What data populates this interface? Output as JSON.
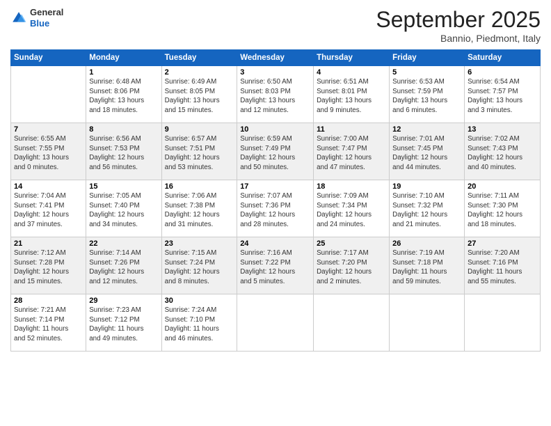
{
  "logo": {
    "general": "General",
    "blue": "Blue"
  },
  "header": {
    "month": "September 2025",
    "location": "Bannio, Piedmont, Italy"
  },
  "days_of_week": [
    "Sunday",
    "Monday",
    "Tuesday",
    "Wednesday",
    "Thursday",
    "Friday",
    "Saturday"
  ],
  "weeks": [
    [
      {
        "day": "",
        "info": ""
      },
      {
        "day": "1",
        "info": "Sunrise: 6:48 AM\nSunset: 8:06 PM\nDaylight: 13 hours\nand 18 minutes."
      },
      {
        "day": "2",
        "info": "Sunrise: 6:49 AM\nSunset: 8:05 PM\nDaylight: 13 hours\nand 15 minutes."
      },
      {
        "day": "3",
        "info": "Sunrise: 6:50 AM\nSunset: 8:03 PM\nDaylight: 13 hours\nand 12 minutes."
      },
      {
        "day": "4",
        "info": "Sunrise: 6:51 AM\nSunset: 8:01 PM\nDaylight: 13 hours\nand 9 minutes."
      },
      {
        "day": "5",
        "info": "Sunrise: 6:53 AM\nSunset: 7:59 PM\nDaylight: 13 hours\nand 6 minutes."
      },
      {
        "day": "6",
        "info": "Sunrise: 6:54 AM\nSunset: 7:57 PM\nDaylight: 13 hours\nand 3 minutes."
      }
    ],
    [
      {
        "day": "7",
        "info": "Sunrise: 6:55 AM\nSunset: 7:55 PM\nDaylight: 13 hours\nand 0 minutes."
      },
      {
        "day": "8",
        "info": "Sunrise: 6:56 AM\nSunset: 7:53 PM\nDaylight: 12 hours\nand 56 minutes."
      },
      {
        "day": "9",
        "info": "Sunrise: 6:57 AM\nSunset: 7:51 PM\nDaylight: 12 hours\nand 53 minutes."
      },
      {
        "day": "10",
        "info": "Sunrise: 6:59 AM\nSunset: 7:49 PM\nDaylight: 12 hours\nand 50 minutes."
      },
      {
        "day": "11",
        "info": "Sunrise: 7:00 AM\nSunset: 7:47 PM\nDaylight: 12 hours\nand 47 minutes."
      },
      {
        "day": "12",
        "info": "Sunrise: 7:01 AM\nSunset: 7:45 PM\nDaylight: 12 hours\nand 44 minutes."
      },
      {
        "day": "13",
        "info": "Sunrise: 7:02 AM\nSunset: 7:43 PM\nDaylight: 12 hours\nand 40 minutes."
      }
    ],
    [
      {
        "day": "14",
        "info": "Sunrise: 7:04 AM\nSunset: 7:41 PM\nDaylight: 12 hours\nand 37 minutes."
      },
      {
        "day": "15",
        "info": "Sunrise: 7:05 AM\nSunset: 7:40 PM\nDaylight: 12 hours\nand 34 minutes."
      },
      {
        "day": "16",
        "info": "Sunrise: 7:06 AM\nSunset: 7:38 PM\nDaylight: 12 hours\nand 31 minutes."
      },
      {
        "day": "17",
        "info": "Sunrise: 7:07 AM\nSunset: 7:36 PM\nDaylight: 12 hours\nand 28 minutes."
      },
      {
        "day": "18",
        "info": "Sunrise: 7:09 AM\nSunset: 7:34 PM\nDaylight: 12 hours\nand 24 minutes."
      },
      {
        "day": "19",
        "info": "Sunrise: 7:10 AM\nSunset: 7:32 PM\nDaylight: 12 hours\nand 21 minutes."
      },
      {
        "day": "20",
        "info": "Sunrise: 7:11 AM\nSunset: 7:30 PM\nDaylight: 12 hours\nand 18 minutes."
      }
    ],
    [
      {
        "day": "21",
        "info": "Sunrise: 7:12 AM\nSunset: 7:28 PM\nDaylight: 12 hours\nand 15 minutes."
      },
      {
        "day": "22",
        "info": "Sunrise: 7:14 AM\nSunset: 7:26 PM\nDaylight: 12 hours\nand 12 minutes."
      },
      {
        "day": "23",
        "info": "Sunrise: 7:15 AM\nSunset: 7:24 PM\nDaylight: 12 hours\nand 8 minutes."
      },
      {
        "day": "24",
        "info": "Sunrise: 7:16 AM\nSunset: 7:22 PM\nDaylight: 12 hours\nand 5 minutes."
      },
      {
        "day": "25",
        "info": "Sunrise: 7:17 AM\nSunset: 7:20 PM\nDaylight: 12 hours\nand 2 minutes."
      },
      {
        "day": "26",
        "info": "Sunrise: 7:19 AM\nSunset: 7:18 PM\nDaylight: 11 hours\nand 59 minutes."
      },
      {
        "day": "27",
        "info": "Sunrise: 7:20 AM\nSunset: 7:16 PM\nDaylight: 11 hours\nand 55 minutes."
      }
    ],
    [
      {
        "day": "28",
        "info": "Sunrise: 7:21 AM\nSunset: 7:14 PM\nDaylight: 11 hours\nand 52 minutes."
      },
      {
        "day": "29",
        "info": "Sunrise: 7:23 AM\nSunset: 7:12 PM\nDaylight: 11 hours\nand 49 minutes."
      },
      {
        "day": "30",
        "info": "Sunrise: 7:24 AM\nSunset: 7:10 PM\nDaylight: 11 hours\nand 46 minutes."
      },
      {
        "day": "",
        "info": ""
      },
      {
        "day": "",
        "info": ""
      },
      {
        "day": "",
        "info": ""
      },
      {
        "day": "",
        "info": ""
      }
    ]
  ]
}
